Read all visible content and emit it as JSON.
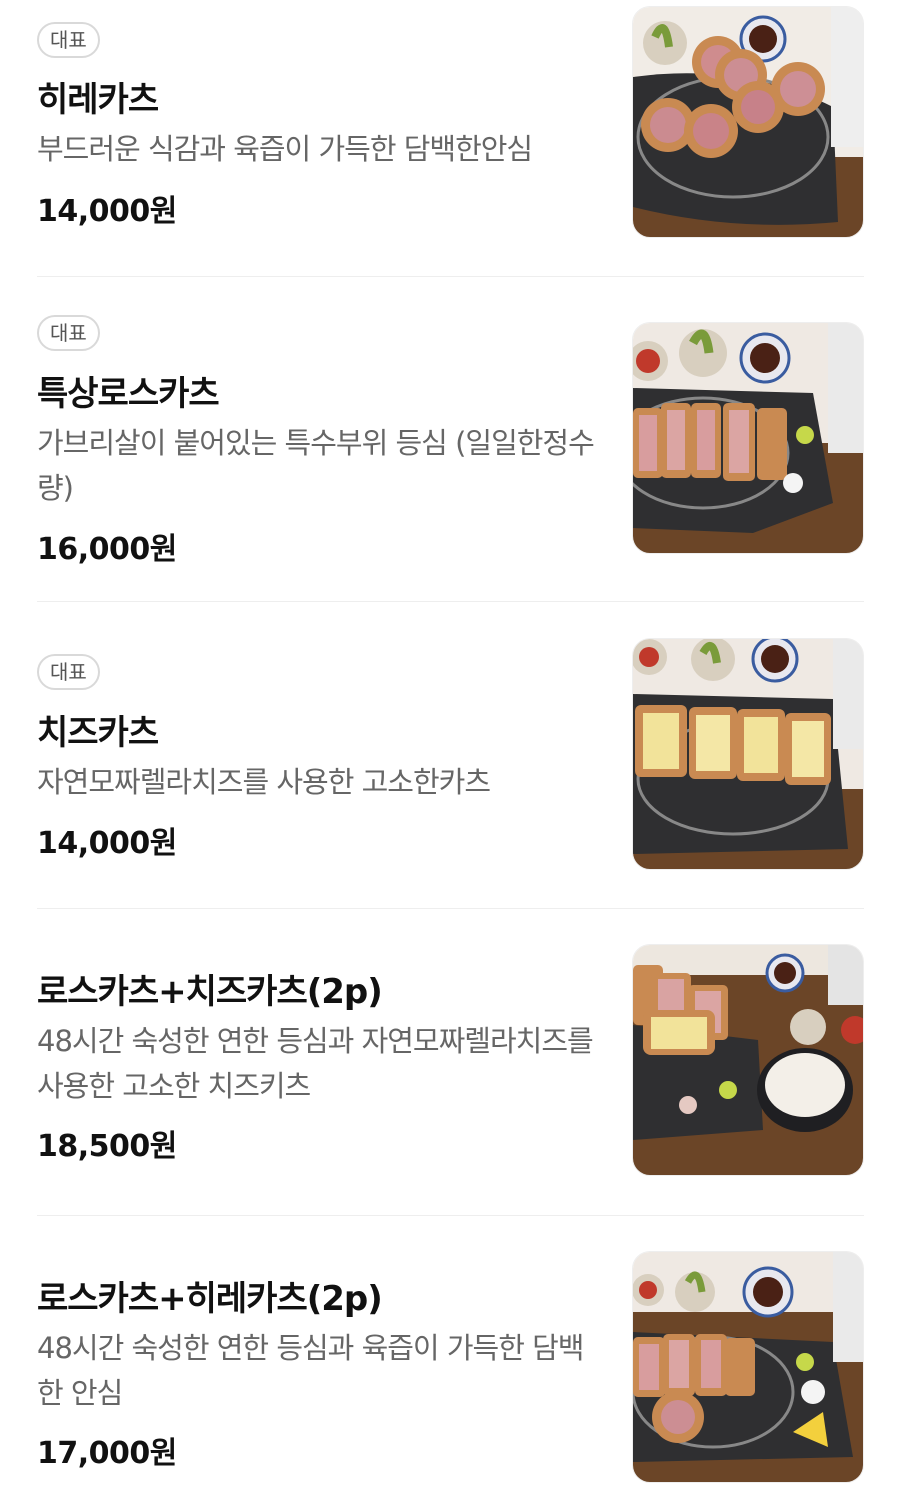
{
  "items": [
    {
      "badge": "대표",
      "name": "히레카츠",
      "desc": "부드러운 식감과 육즙이 가득한 담백한안심",
      "price": "14,000원",
      "image": "hire-katsu-photo"
    },
    {
      "badge": "대표",
      "name": "특상로스카츠",
      "desc": "가브리살이 붙어있는 특수부위 등심 (일일한정수량)",
      "price": "16,000원",
      "image": "special-rosu-katsu-photo"
    },
    {
      "badge": "대표",
      "name": "치즈카츠",
      "desc": "자연모짜렐라치즈를 사용한 고소한카츠",
      "price": "14,000원",
      "image": "cheese-katsu-photo"
    },
    {
      "badge": "",
      "name": "로스카츠+치즈카츠(2p)",
      "desc": "48시간 숙성한 연한 등심과 자연모짜렐라치즈를 사용한 고소한 치즈키츠",
      "price": "18,500원",
      "image": "rosu-cheese-katsu-photo"
    },
    {
      "badge": "",
      "name": "로스카츠+히레카츠(2p)",
      "desc": "48시간 숙성한 연한 등심과 육즙이 가득한 담백한 안심",
      "price": "17,000원",
      "image": "rosu-hire-katsu-photo"
    }
  ]
}
